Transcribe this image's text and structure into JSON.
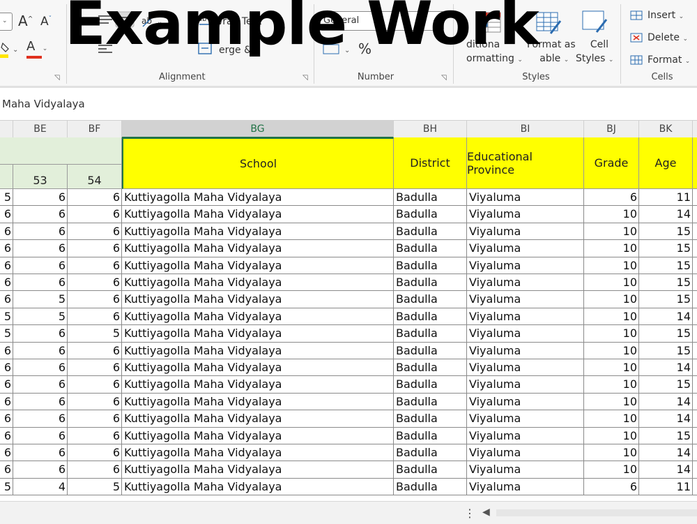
{
  "watermark": "Example Work",
  "ribbon": {
    "font": {
      "increase_size_label": "A",
      "decrease_size_label": "A",
      "font_color_letter": "A"
    },
    "alignment": {
      "wrap_text_label": "Wrap Text",
      "merge_label": "erge &",
      "group_label": "Alignment"
    },
    "number": {
      "format_value": "General",
      "percent_label": "%",
      "group_label": "Number"
    },
    "styles": {
      "conditional_label_line1": "ditiona",
      "conditional_label_line2": "ormatting",
      "format_as_table_line1": "Format as",
      "format_as_table_line2": "able",
      "cell_styles_line1": "Cell",
      "cell_styles_line2": "Styles",
      "group_label": "Styles"
    },
    "cells": {
      "insert_label": "Insert",
      "delete_label": "Delete",
      "format_label": "Format",
      "group_label": "Cells"
    }
  },
  "formula_bar": {
    "value": "Maha Vidyalaya"
  },
  "columns": [
    {
      "letter": "",
      "active": false
    },
    {
      "letter": "BE",
      "active": false
    },
    {
      "letter": "BF",
      "active": false
    },
    {
      "letter": "BG",
      "active": true
    },
    {
      "letter": "BH",
      "active": false
    },
    {
      "letter": "BI",
      "active": false
    },
    {
      "letter": "BJ",
      "active": false
    },
    {
      "letter": "BK",
      "active": false
    }
  ],
  "header_row": {
    "col_be_number": "53",
    "col_bf_number": "54",
    "school": "School",
    "district": "District",
    "province": "Educational Province",
    "grade": "Grade",
    "age": "Age"
  },
  "rows": [
    {
      "prev": "5",
      "be": "6",
      "bf": "6",
      "school": "Kuttiyagolla Maha Vidyalaya",
      "district": "Badulla",
      "province": "Viyaluma",
      "grade": "6",
      "age": "11"
    },
    {
      "prev": "6",
      "be": "6",
      "bf": "6",
      "school": "Kuttiyagolla Maha Vidyalaya",
      "district": "Badulla",
      "province": "Viyaluma",
      "grade": "10",
      "age": "14"
    },
    {
      "prev": "6",
      "be": "6",
      "bf": "6",
      "school": "Kuttiyagolla Maha Vidyalaya",
      "district": "Badulla",
      "province": "Viyaluma",
      "grade": "10",
      "age": "15"
    },
    {
      "prev": "6",
      "be": "6",
      "bf": "6",
      "school": "Kuttiyagolla Maha Vidyalaya",
      "district": "Badulla",
      "province": "Viyaluma",
      "grade": "10",
      "age": "15"
    },
    {
      "prev": "6",
      "be": "6",
      "bf": "6",
      "school": "Kuttiyagolla Maha Vidyalaya",
      "district": "Badulla",
      "province": "Viyaluma",
      "grade": "10",
      "age": "15"
    },
    {
      "prev": "6",
      "be": "6",
      "bf": "6",
      "school": "Kuttiyagolla Maha Vidyalaya",
      "district": "Badulla",
      "province": "Viyaluma",
      "grade": "10",
      "age": "15"
    },
    {
      "prev": "6",
      "be": "5",
      "bf": "6",
      "school": "Kuttiyagolla Maha Vidyalaya",
      "district": "Badulla",
      "province": "Viyaluma",
      "grade": "10",
      "age": "15"
    },
    {
      "prev": "5",
      "be": "5",
      "bf": "6",
      "school": "Kuttiyagolla Maha Vidyalaya",
      "district": "Badulla",
      "province": "Viyaluma",
      "grade": "10",
      "age": "14"
    },
    {
      "prev": "5",
      "be": "6",
      "bf": "5",
      "school": "Kuttiyagolla Maha Vidyalaya",
      "district": "Badulla",
      "province": "Viyaluma",
      "grade": "10",
      "age": "15"
    },
    {
      "prev": "6",
      "be": "6",
      "bf": "6",
      "school": "Kuttiyagolla Maha Vidyalaya",
      "district": "Badulla",
      "province": "Viyaluma",
      "grade": "10",
      "age": "15"
    },
    {
      "prev": "6",
      "be": "6",
      "bf": "6",
      "school": "Kuttiyagolla Maha Vidyalaya",
      "district": "Badulla",
      "province": "Viyaluma",
      "grade": "10",
      "age": "14"
    },
    {
      "prev": "6",
      "be": "6",
      "bf": "6",
      "school": "Kuttiyagolla Maha Vidyalaya",
      "district": "Badulla",
      "province": "Viyaluma",
      "grade": "10",
      "age": "15"
    },
    {
      "prev": "6",
      "be": "6",
      "bf": "6",
      "school": "Kuttiyagolla Maha Vidyalaya",
      "district": "Badulla",
      "province": "Viyaluma",
      "grade": "10",
      "age": "14"
    },
    {
      "prev": "6",
      "be": "6",
      "bf": "6",
      "school": "Kuttiyagolla Maha Vidyalaya",
      "district": "Badulla",
      "province": "Viyaluma",
      "grade": "10",
      "age": "14"
    },
    {
      "prev": "6",
      "be": "6",
      "bf": "6",
      "school": "Kuttiyagolla Maha Vidyalaya",
      "district": "Badulla",
      "province": "Viyaluma",
      "grade": "10",
      "age": "15"
    },
    {
      "prev": "6",
      "be": "6",
      "bf": "6",
      "school": "Kuttiyagolla Maha Vidyalaya",
      "district": "Badulla",
      "province": "Viyaluma",
      "grade": "10",
      "age": "14"
    },
    {
      "prev": "6",
      "be": "6",
      "bf": "6",
      "school": "Kuttiyagolla Maha Vidyalaya",
      "district": "Badulla",
      "province": "Viyaluma",
      "grade": "10",
      "age": "14"
    },
    {
      "prev": "5",
      "be": "4",
      "bf": "5",
      "school": "Kuttiyagolla Maha Vidyalaya",
      "district": "Badulla",
      "province": "Viyaluma",
      "grade": "6",
      "age": "11"
    }
  ],
  "colors": {
    "header_yellow": "#ffff00",
    "header_green": "#e2efda",
    "active_column": "#217346",
    "font_color_red": "#e0301e",
    "highlight_yellow": "#ffe600"
  },
  "icons": [
    "increase-font-icon",
    "decrease-font-icon",
    "highlight-icon",
    "font-color-icon",
    "align-icon",
    "orientation-icon",
    "wrap-text-icon",
    "merge-icon",
    "percent-icon",
    "conditional-formatting-icon",
    "format-as-table-icon",
    "cell-styles-icon",
    "insert-cells-icon",
    "delete-cells-icon",
    "format-cells-icon",
    "dialog-launcher-icon",
    "more-options-icon",
    "scroll-left-icon"
  ]
}
